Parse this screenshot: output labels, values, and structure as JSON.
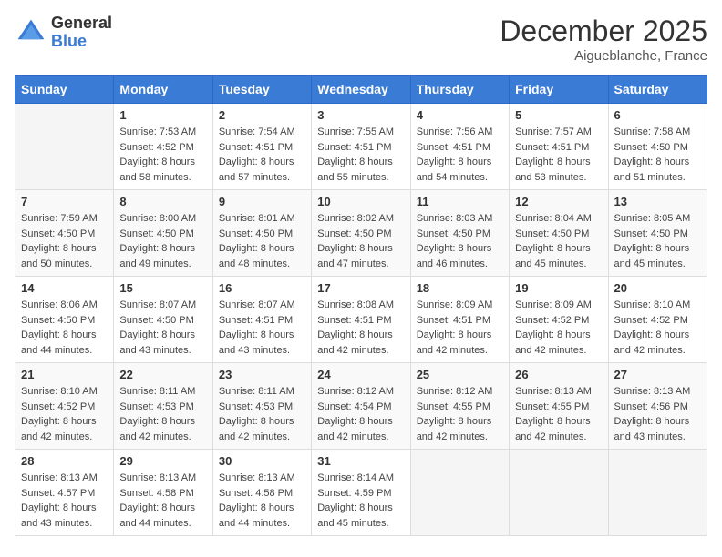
{
  "logo": {
    "general": "General",
    "blue": "Blue"
  },
  "title": "December 2025",
  "location": "Aigueblanche, France",
  "days_of_week": [
    "Sunday",
    "Monday",
    "Tuesday",
    "Wednesday",
    "Thursday",
    "Friday",
    "Saturday"
  ],
  "weeks": [
    [
      {
        "day": "",
        "sunrise": "",
        "sunset": "",
        "daylight": ""
      },
      {
        "day": "1",
        "sunrise": "Sunrise: 7:53 AM",
        "sunset": "Sunset: 4:52 PM",
        "daylight": "Daylight: 8 hours and 58 minutes."
      },
      {
        "day": "2",
        "sunrise": "Sunrise: 7:54 AM",
        "sunset": "Sunset: 4:51 PM",
        "daylight": "Daylight: 8 hours and 57 minutes."
      },
      {
        "day": "3",
        "sunrise": "Sunrise: 7:55 AM",
        "sunset": "Sunset: 4:51 PM",
        "daylight": "Daylight: 8 hours and 55 minutes."
      },
      {
        "day": "4",
        "sunrise": "Sunrise: 7:56 AM",
        "sunset": "Sunset: 4:51 PM",
        "daylight": "Daylight: 8 hours and 54 minutes."
      },
      {
        "day": "5",
        "sunrise": "Sunrise: 7:57 AM",
        "sunset": "Sunset: 4:51 PM",
        "daylight": "Daylight: 8 hours and 53 minutes."
      },
      {
        "day": "6",
        "sunrise": "Sunrise: 7:58 AM",
        "sunset": "Sunset: 4:50 PM",
        "daylight": "Daylight: 8 hours and 51 minutes."
      }
    ],
    [
      {
        "day": "7",
        "sunrise": "Sunrise: 7:59 AM",
        "sunset": "Sunset: 4:50 PM",
        "daylight": "Daylight: 8 hours and 50 minutes."
      },
      {
        "day": "8",
        "sunrise": "Sunrise: 8:00 AM",
        "sunset": "Sunset: 4:50 PM",
        "daylight": "Daylight: 8 hours and 49 minutes."
      },
      {
        "day": "9",
        "sunrise": "Sunrise: 8:01 AM",
        "sunset": "Sunset: 4:50 PM",
        "daylight": "Daylight: 8 hours and 48 minutes."
      },
      {
        "day": "10",
        "sunrise": "Sunrise: 8:02 AM",
        "sunset": "Sunset: 4:50 PM",
        "daylight": "Daylight: 8 hours and 47 minutes."
      },
      {
        "day": "11",
        "sunrise": "Sunrise: 8:03 AM",
        "sunset": "Sunset: 4:50 PM",
        "daylight": "Daylight: 8 hours and 46 minutes."
      },
      {
        "day": "12",
        "sunrise": "Sunrise: 8:04 AM",
        "sunset": "Sunset: 4:50 PM",
        "daylight": "Daylight: 8 hours and 45 minutes."
      },
      {
        "day": "13",
        "sunrise": "Sunrise: 8:05 AM",
        "sunset": "Sunset: 4:50 PM",
        "daylight": "Daylight: 8 hours and 45 minutes."
      }
    ],
    [
      {
        "day": "14",
        "sunrise": "Sunrise: 8:06 AM",
        "sunset": "Sunset: 4:50 PM",
        "daylight": "Daylight: 8 hours and 44 minutes."
      },
      {
        "day": "15",
        "sunrise": "Sunrise: 8:07 AM",
        "sunset": "Sunset: 4:50 PM",
        "daylight": "Daylight: 8 hours and 43 minutes."
      },
      {
        "day": "16",
        "sunrise": "Sunrise: 8:07 AM",
        "sunset": "Sunset: 4:51 PM",
        "daylight": "Daylight: 8 hours and 43 minutes."
      },
      {
        "day": "17",
        "sunrise": "Sunrise: 8:08 AM",
        "sunset": "Sunset: 4:51 PM",
        "daylight": "Daylight: 8 hours and 42 minutes."
      },
      {
        "day": "18",
        "sunrise": "Sunrise: 8:09 AM",
        "sunset": "Sunset: 4:51 PM",
        "daylight": "Daylight: 8 hours and 42 minutes."
      },
      {
        "day": "19",
        "sunrise": "Sunrise: 8:09 AM",
        "sunset": "Sunset: 4:52 PM",
        "daylight": "Daylight: 8 hours and 42 minutes."
      },
      {
        "day": "20",
        "sunrise": "Sunrise: 8:10 AM",
        "sunset": "Sunset: 4:52 PM",
        "daylight": "Daylight: 8 hours and 42 minutes."
      }
    ],
    [
      {
        "day": "21",
        "sunrise": "Sunrise: 8:10 AM",
        "sunset": "Sunset: 4:52 PM",
        "daylight": "Daylight: 8 hours and 42 minutes."
      },
      {
        "day": "22",
        "sunrise": "Sunrise: 8:11 AM",
        "sunset": "Sunset: 4:53 PM",
        "daylight": "Daylight: 8 hours and 42 minutes."
      },
      {
        "day": "23",
        "sunrise": "Sunrise: 8:11 AM",
        "sunset": "Sunset: 4:53 PM",
        "daylight": "Daylight: 8 hours and 42 minutes."
      },
      {
        "day": "24",
        "sunrise": "Sunrise: 8:12 AM",
        "sunset": "Sunset: 4:54 PM",
        "daylight": "Daylight: 8 hours and 42 minutes."
      },
      {
        "day": "25",
        "sunrise": "Sunrise: 8:12 AM",
        "sunset": "Sunset: 4:55 PM",
        "daylight": "Daylight: 8 hours and 42 minutes."
      },
      {
        "day": "26",
        "sunrise": "Sunrise: 8:13 AM",
        "sunset": "Sunset: 4:55 PM",
        "daylight": "Daylight: 8 hours and 42 minutes."
      },
      {
        "day": "27",
        "sunrise": "Sunrise: 8:13 AM",
        "sunset": "Sunset: 4:56 PM",
        "daylight": "Daylight: 8 hours and 43 minutes."
      }
    ],
    [
      {
        "day": "28",
        "sunrise": "Sunrise: 8:13 AM",
        "sunset": "Sunset: 4:57 PM",
        "daylight": "Daylight: 8 hours and 43 minutes."
      },
      {
        "day": "29",
        "sunrise": "Sunrise: 8:13 AM",
        "sunset": "Sunset: 4:58 PM",
        "daylight": "Daylight: 8 hours and 44 minutes."
      },
      {
        "day": "30",
        "sunrise": "Sunrise: 8:13 AM",
        "sunset": "Sunset: 4:58 PM",
        "daylight": "Daylight: 8 hours and 44 minutes."
      },
      {
        "day": "31",
        "sunrise": "Sunrise: 8:14 AM",
        "sunset": "Sunset: 4:59 PM",
        "daylight": "Daylight: 8 hours and 45 minutes."
      },
      {
        "day": "",
        "sunrise": "",
        "sunset": "",
        "daylight": ""
      },
      {
        "day": "",
        "sunrise": "",
        "sunset": "",
        "daylight": ""
      },
      {
        "day": "",
        "sunrise": "",
        "sunset": "",
        "daylight": ""
      }
    ]
  ]
}
